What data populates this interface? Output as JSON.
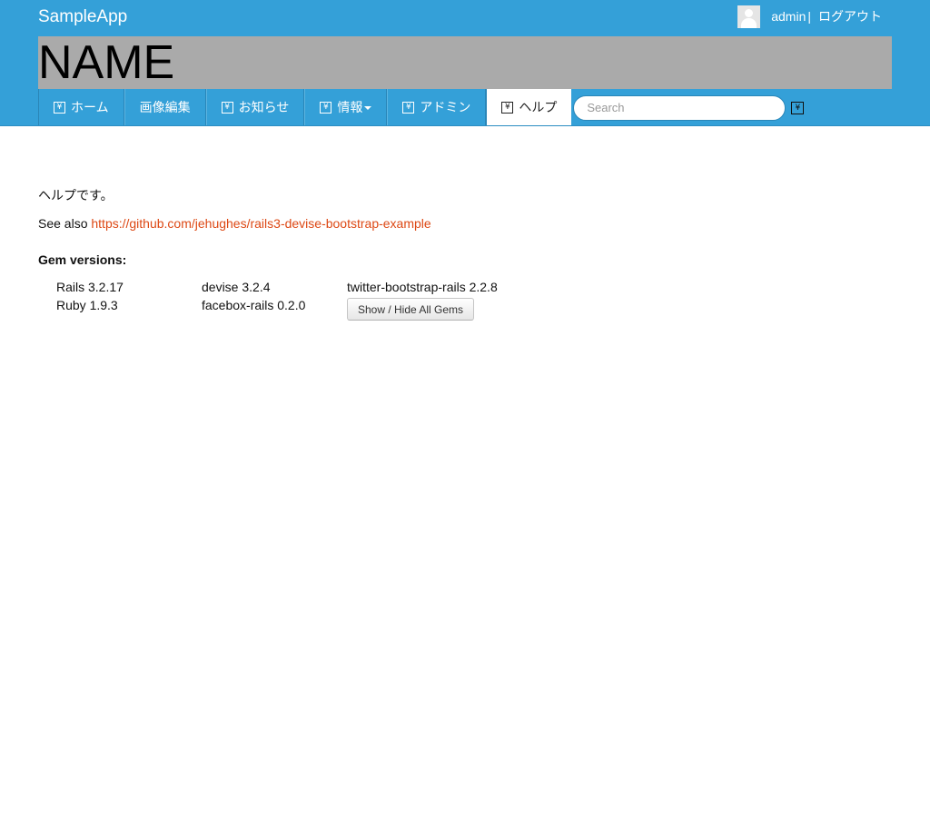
{
  "header": {
    "brand": "SampleApp",
    "user": {
      "name": "admin",
      "separator": "|",
      "logout": "ログアウト"
    },
    "banner_text": "NAME"
  },
  "nav": {
    "items": [
      {
        "label": "ホーム",
        "icon": "home-icon",
        "has_icon": true
      },
      {
        "label": "画像編集",
        "icon": "",
        "has_icon": false
      },
      {
        "label": "お知らせ",
        "icon": "notice-icon",
        "has_icon": true
      },
      {
        "label": "情報",
        "icon": "info-icon",
        "has_icon": true,
        "dropdown": true
      },
      {
        "label": "アドミン",
        "icon": "admin-icon",
        "has_icon": true
      },
      {
        "label": "ヘルプ",
        "icon": "help-icon",
        "has_icon": true,
        "active": true
      }
    ],
    "search_placeholder": "Search"
  },
  "main": {
    "help_text": "ヘルプです。",
    "see_also_prefix": "See also",
    "see_also_link": "https://github.com/jehughes/rails3-devise-bootstrap-example",
    "gem_heading": "Gem versions:",
    "gems": {
      "row1": [
        "Rails 3.2.17",
        "devise 3.2.4",
        "twitter-bootstrap-rails 2.2.8"
      ],
      "row2": [
        "Ruby 1.9.3",
        "facebox-rails 0.2.0"
      ]
    },
    "toggle_button": "Show / Hide All Gems"
  },
  "colors": {
    "header_bg": "#34a0d8",
    "banner_bg": "#aaaaaa",
    "link": "#dd4814"
  }
}
